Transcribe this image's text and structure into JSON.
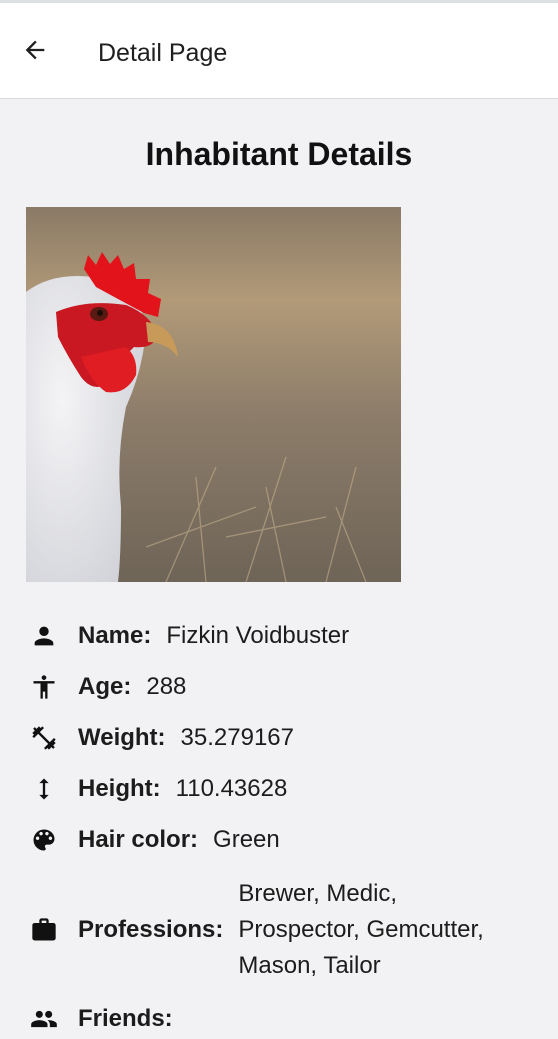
{
  "appbar": {
    "title": "Detail Page",
    "back_icon": "arrow-left-icon"
  },
  "page": {
    "title": "Inhabitant Details"
  },
  "photo": {
    "subject": "white hen with red comb"
  },
  "details": [
    {
      "icon": "person-icon",
      "label": "Name:",
      "value": "Fizkin Voidbuster"
    },
    {
      "icon": "accessibility-icon",
      "label": "Age:",
      "value": "288"
    },
    {
      "icon": "dumbbell-icon",
      "label": "Weight:",
      "value": "35.279167"
    },
    {
      "icon": "height-arrows-icon",
      "label": "Height:",
      "value": "110.43628"
    },
    {
      "icon": "palette-icon",
      "label": "Hair color:",
      "value": "Green"
    },
    {
      "icon": "briefcase-icon",
      "label": "Professions:",
      "value": "Brewer, Medic, Prospector, Gemcutter, Mason, Tailor"
    },
    {
      "icon": "people-icon",
      "label": "Friends:",
      "value": ""
    }
  ]
}
